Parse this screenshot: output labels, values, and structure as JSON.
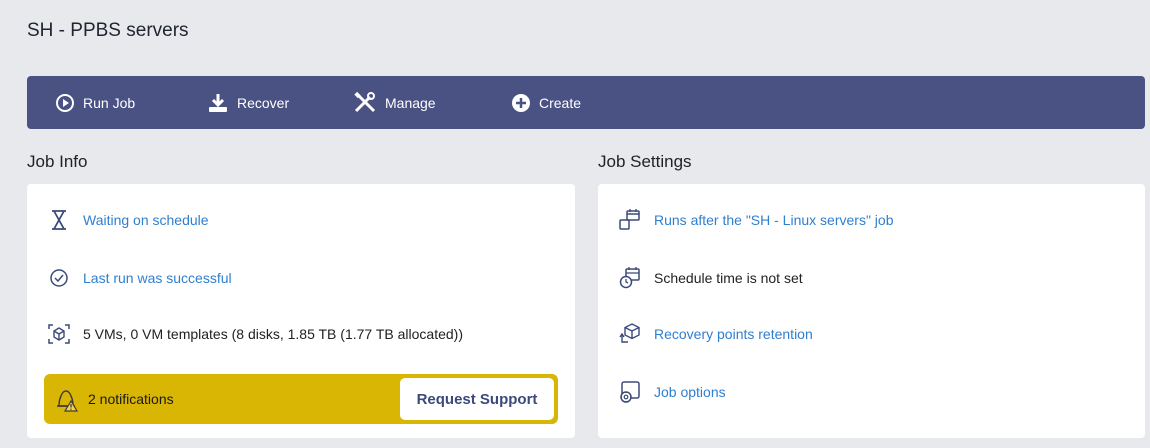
{
  "page": {
    "title": "SH - PPBS servers"
  },
  "toolbar": {
    "run_job": "Run Job",
    "recover": "Recover",
    "manage": "Manage",
    "create": "Create"
  },
  "job_info": {
    "title": "Job Info",
    "status": "Waiting on schedule",
    "last_run": "Last run was successful",
    "summary": "5 VMs, 0 VM templates (8 disks, 1.85 TB (1.77 TB allocated))",
    "notifications": "2 notifications",
    "request_support": "Request Support"
  },
  "job_settings": {
    "title": "Job Settings",
    "runs_after": "Runs after the \"SH - Linux servers\" job",
    "schedule": "Schedule time is not set",
    "retention": "Recovery points retention",
    "options": "Job options"
  },
  "colors": {
    "toolbar_bg": "#4a5183",
    "link": "#2f7fd0",
    "notification_bg": "#d9b504",
    "page_bg": "#e8e9ed"
  }
}
